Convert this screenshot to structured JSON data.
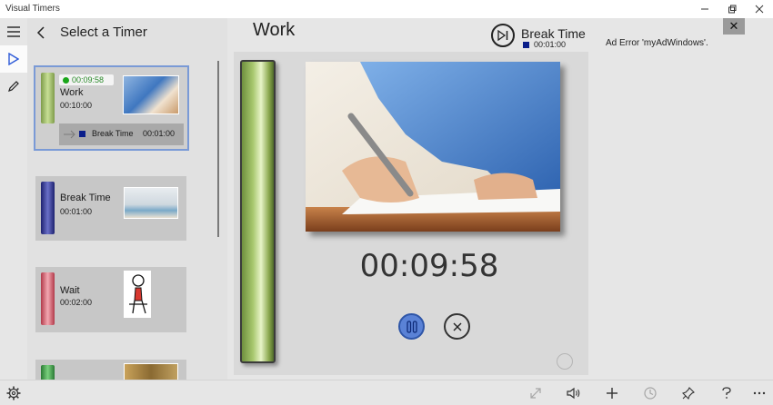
{
  "window": {
    "title": "Visual Timers",
    "controls": [
      "minimize",
      "restore",
      "close"
    ]
  },
  "rail": {
    "items": [
      {
        "icon": "hamburger-icon",
        "active": false
      },
      {
        "icon": "play-icon",
        "active": true
      },
      {
        "icon": "pencil-icon",
        "active": false
      }
    ]
  },
  "list": {
    "title": "Select a Timer",
    "timers": [
      {
        "name": "Work",
        "duration": "00:10:00",
        "running_time": "00:09:58",
        "color": "#8fb25a",
        "selected": true,
        "next": {
          "name": "Break Time",
          "duration": "00:01:00",
          "color": "#0a1e8a"
        }
      },
      {
        "name": "Break Time",
        "duration": "00:01:00",
        "color": "#2b2f8a",
        "selected": false
      },
      {
        "name": "Wait",
        "duration": "00:02:00",
        "color": "#e06a7a",
        "selected": false
      },
      {
        "name": "",
        "duration": "",
        "color": "#3aa046",
        "selected": false
      }
    ]
  },
  "main": {
    "title": "Work",
    "next": {
      "label": "Break Time",
      "time": "00:01:00"
    },
    "countdown": "00:09:58",
    "progress_fraction": 0.997,
    "bar_color": "#a8c86e"
  },
  "ad": {
    "error": "Ad Error 'myAdWindows'.",
    "close": "✕"
  },
  "bottombar": {
    "icons": [
      "fullscreen-icon",
      "volume-icon",
      "add-icon",
      "clock-icon",
      "pin-icon",
      "help-icon",
      "more-icon"
    ]
  },
  "settings_icon": "gear-icon"
}
